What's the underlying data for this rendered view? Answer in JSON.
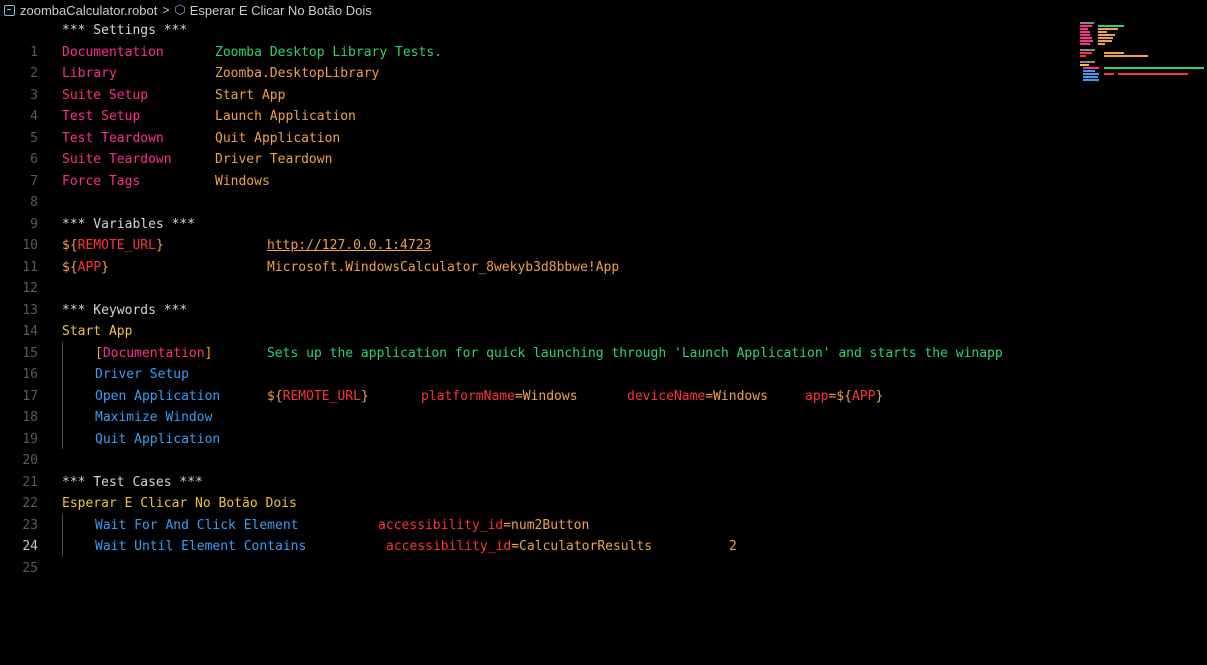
{
  "breadcrumb": {
    "file": "zoombaCalculator.robot",
    "separator": ">",
    "symbol": "Esperar E Clicar No Botão Dois"
  },
  "colors": {
    "background": "#000000",
    "setting": "#ff2d8a",
    "value": "#f0a04b",
    "green": "#2ed36a",
    "keyword": "#3b9cf5",
    "red": "#ff3333"
  },
  "editor": {
    "active_line": "24",
    "line_numbers": [
      "1",
      "2",
      "3",
      "4",
      "5",
      "6",
      "7",
      "8",
      "9",
      "10",
      "11",
      "12",
      "13",
      "14",
      "15",
      "16",
      "17",
      "18",
      "19",
      "20",
      "21",
      "22",
      "23",
      "24",
      "25"
    ],
    "lines": {
      "l1": {
        "a": "*** Settings ***"
      },
      "l2": {
        "a": "Documentation",
        "b": "Zoomba Desktop Library Tests."
      },
      "l3": {
        "a": "Library",
        "b": "Zoomba.DesktopLibrary"
      },
      "l4": {
        "a": "Suite Setup",
        "b": "Start App"
      },
      "l5": {
        "a": "Test Setup",
        "b": "Launch Application"
      },
      "l6": {
        "a": "Test Teardown",
        "b": "Quit Application"
      },
      "l7": {
        "a": "Suite Teardown",
        "b": "Driver Teardown"
      },
      "l8": {
        "a": "Force Tags",
        "b": "Windows"
      },
      "l10": {
        "a": "*** Variables ***"
      },
      "l11": {
        "a1": "${",
        "a2": "REMOTE_URL",
        "a3": "}",
        "b": "http://127.0.0.1:4723"
      },
      "l12": {
        "a1": "${",
        "a2": "APP",
        "a3": "}",
        "b": "Microsoft.WindowsCalculator_8wekyb3d8bbwe!App"
      },
      "l14": {
        "a": "*** Keywords ***"
      },
      "l15": {
        "a": "Start App"
      },
      "l16": {
        "a1": "[",
        "a2": "Documentation",
        "a3": "]",
        "b": "Sets up the application for quick launching through 'Launch Application' and starts the winapp"
      },
      "l17": {
        "a": "Driver Setup"
      },
      "l18": {
        "a": "Open Application",
        "b1": "${",
        "b2": "REMOTE_URL",
        "b3": "}",
        "c1": "platformName",
        "c2": "=Windows",
        "d1": "deviceName",
        "d2": "=Windows",
        "e1": "app",
        "e2": "=${",
        "e3": "APP",
        "e4": "}"
      },
      "l19": {
        "a": "Maximize Window"
      },
      "l20": {
        "a": "Quit Application"
      },
      "l22": {
        "a": "*** Test Cases ***"
      },
      "l23": {
        "a": "Esperar E Clicar No Botão Dois"
      },
      "l24": {
        "a": "Wait For And Click Element",
        "b1": "accessibility_id",
        "b2": "=num2Button"
      },
      "l25": {
        "a": "Wait Until Element Contains",
        "b1": "accessibility_id",
        "b2": "=CalculatorResults",
        "c": "2"
      }
    }
  }
}
